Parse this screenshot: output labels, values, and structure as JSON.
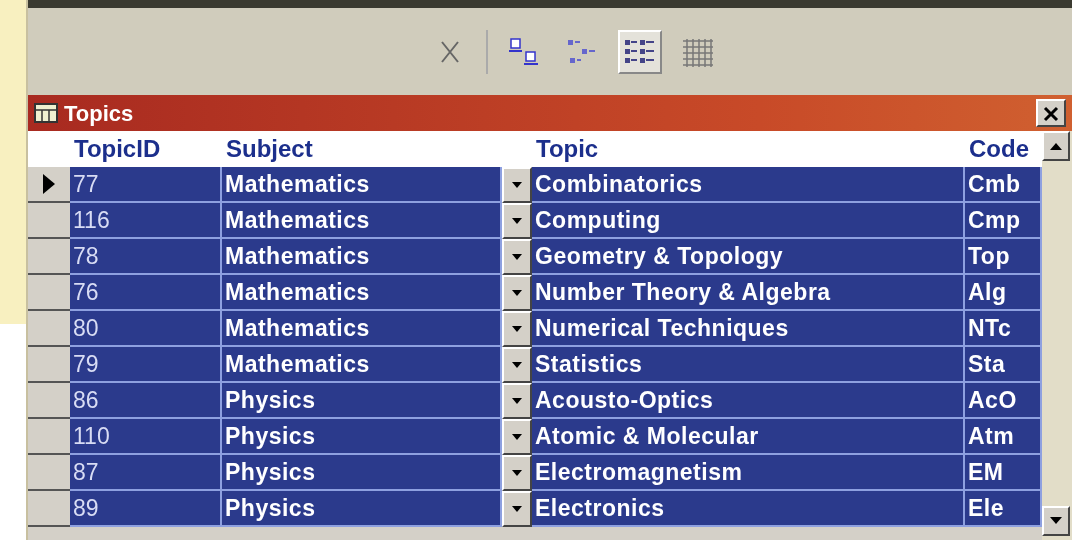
{
  "toolbar": {
    "buttons": [
      {
        "kind": "cut",
        "selected": false
      },
      {
        "kind": "sep"
      },
      {
        "kind": "large-icons",
        "selected": false
      },
      {
        "kind": "small-icons",
        "selected": false
      },
      {
        "kind": "list",
        "selected": true
      },
      {
        "kind": "details",
        "selected": false
      }
    ]
  },
  "window": {
    "title": "Topics"
  },
  "table": {
    "columns": [
      "TopicID",
      "Subject",
      "Topic",
      "Code"
    ],
    "rows": [
      {
        "current": true,
        "selected": true,
        "cells": [
          "77",
          "Mathematics",
          "Combinatorics",
          "Cmb"
        ]
      },
      {
        "current": false,
        "selected": true,
        "cells": [
          "116",
          "Mathematics",
          "Computing",
          "Cmp"
        ]
      },
      {
        "current": false,
        "selected": true,
        "cells": [
          "78",
          "Mathematics",
          "Geometry & Topology",
          "Top"
        ]
      },
      {
        "current": false,
        "selected": true,
        "cells": [
          "76",
          "Mathematics",
          "Number Theory & Algebra",
          "Alg"
        ]
      },
      {
        "current": false,
        "selected": true,
        "cells": [
          "80",
          "Mathematics",
          "Numerical Techniques",
          "NTc"
        ]
      },
      {
        "current": false,
        "selected": true,
        "cells": [
          "79",
          "Mathematics",
          "Statistics",
          "Sta"
        ]
      },
      {
        "current": false,
        "selected": true,
        "cells": [
          "86",
          "Physics",
          "Acousto-Optics",
          "AcO"
        ]
      },
      {
        "current": false,
        "selected": true,
        "cells": [
          "110",
          "Physics",
          "Atomic & Molecular",
          "Atm"
        ]
      },
      {
        "current": false,
        "selected": true,
        "cells": [
          "87",
          "Physics",
          "Electromagnetism",
          "EM"
        ]
      },
      {
        "current": false,
        "selected": true,
        "cells": [
          "89",
          "Physics",
          "Electronics",
          "Ele"
        ]
      }
    ]
  }
}
